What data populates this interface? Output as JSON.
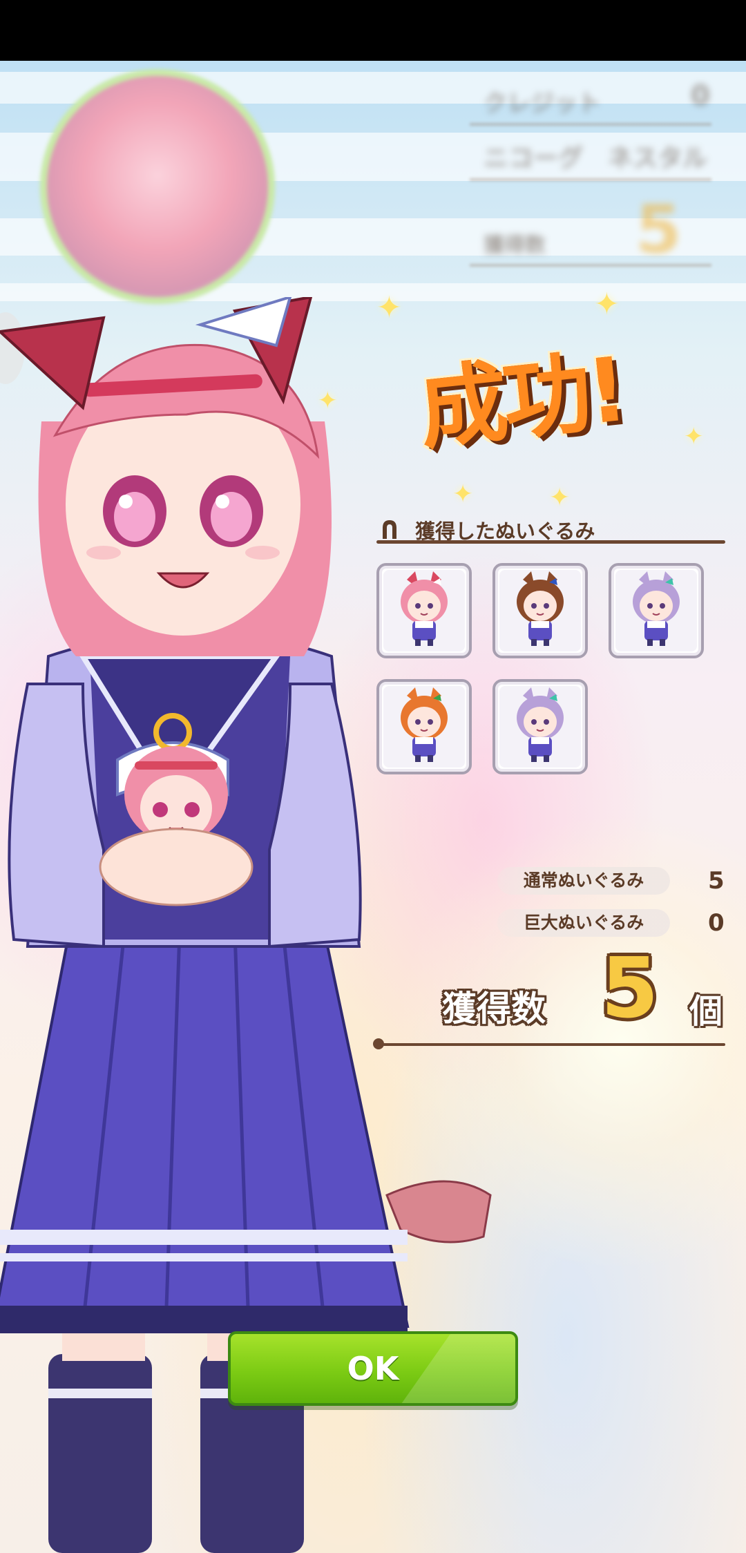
{
  "background": {
    "blurred_rows": [
      {
        "label": "クレジット",
        "value": "0"
      },
      {
        "label": "ニコーグ　ネスタル",
        "value": ""
      },
      {
        "label": "獲得数",
        "value": "5"
      }
    ]
  },
  "result": {
    "title": "成功!",
    "obtained_header": "獲得したぬいぐるみ",
    "plushies": [
      {
        "name": "Haru Urara plush",
        "hair": "#f08fa8",
        "ear": "#d94860",
        "ribbon": "#ffffff"
      },
      {
        "name": "Special Week plush",
        "hair": "#8a4a2a",
        "ear": "#8a4a2a",
        "ribbon": "#2f57c2"
      },
      {
        "name": "Mejiro McQueen plush",
        "hair": "#b7a0d8",
        "ear": "#b7a0d8",
        "ribbon": "#3ec3a8"
      },
      {
        "name": "Silence Suzuka plush",
        "hair": "#e8772f",
        "ear": "#e8772f",
        "ribbon": "#38a34a"
      },
      {
        "name": "Mejiro McQueen plush",
        "hair": "#b7a0d8",
        "ear": "#b7a0d8",
        "ribbon": "#3ec3a8"
      }
    ],
    "normal_label": "通常ぬいぐるみ",
    "normal_count": "5",
    "giant_label": "巨大ぬいぐるみ",
    "giant_count": "0",
    "total_label": "獲得数",
    "total_value": "5",
    "total_unit": "個"
  },
  "ok_button": {
    "label": "OK"
  },
  "colors": {
    "accent_green": "#7ccb14",
    "title_orange": "#ff8a1f",
    "text_brown": "#5b3b27",
    "gold": "#f7c943"
  }
}
